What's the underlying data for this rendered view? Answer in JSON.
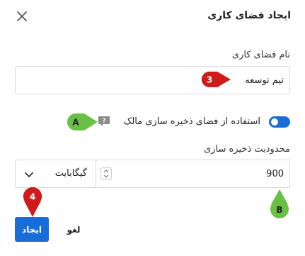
{
  "dialog": {
    "title": "ایجاد فضای کاری",
    "close_icon": "close-icon"
  },
  "workspace_name": {
    "label": "نام فضای کاری",
    "value": "تیم توسعه"
  },
  "owner_storage": {
    "label": "استفاده از فضای ذخیره سازی مالک",
    "enabled": true,
    "help_icon": "question-bubble-icon"
  },
  "storage_limit": {
    "label": "محدودیت ذخیره سازی",
    "value": "900",
    "unit": "گیگابایت",
    "spinner_icon": "up-down-stepper-icon",
    "dropdown_icon": "chevron-down-icon"
  },
  "actions": {
    "create_label": "ایجاد",
    "cancel_label": "لغو"
  },
  "annotations": {
    "marker_3": "3",
    "marker_4": "4",
    "marker_a": "A",
    "marker_b": "B"
  },
  "colors": {
    "accent": "#1a6dd9",
    "marker_red": "#d11a1a",
    "marker_green": "#6abf45"
  }
}
